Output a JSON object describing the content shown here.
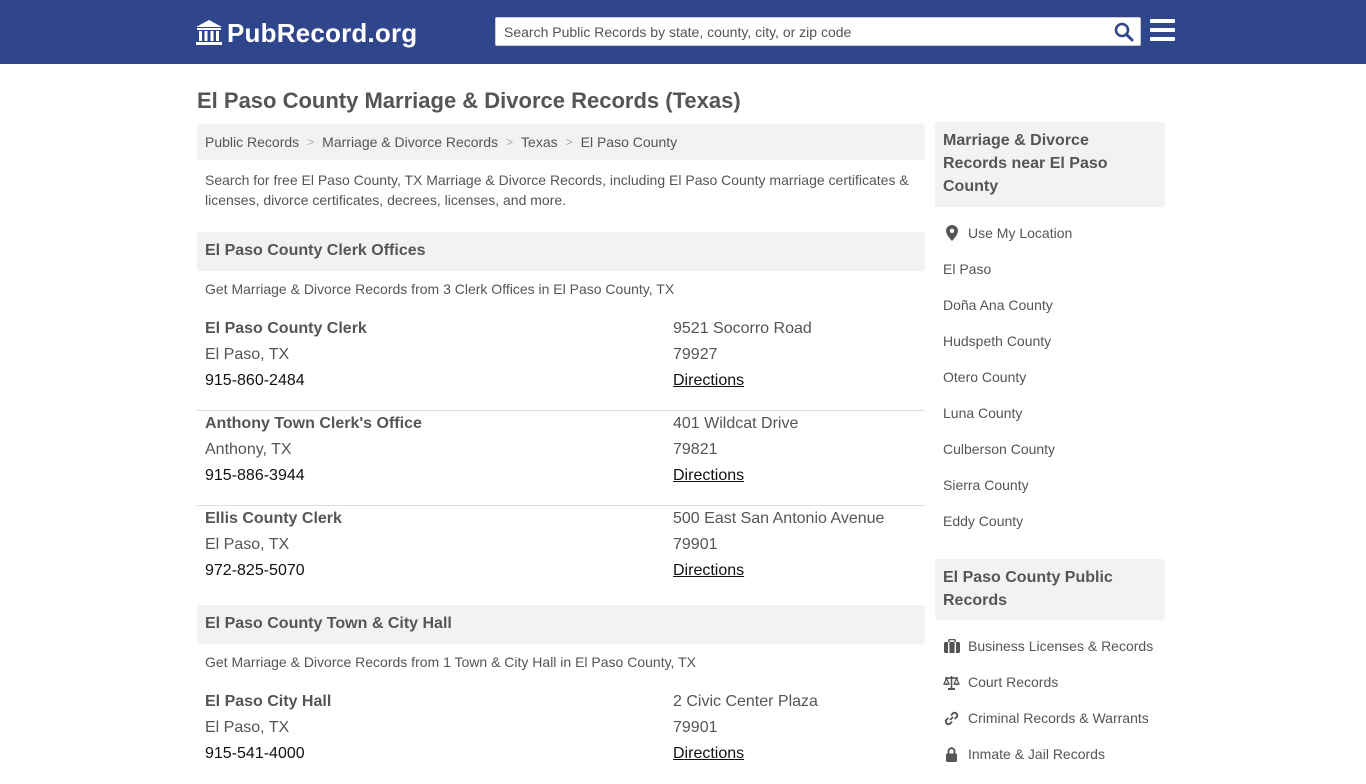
{
  "header": {
    "logo_text": "PubRecord.org",
    "search_placeholder": "Search Public Records by state, county, city, or zip code"
  },
  "page": {
    "title": "El Paso County Marriage & Divorce Records (Texas)",
    "intro": "Search for free El Paso County, TX Marriage & Divorce Records, including El Paso County marriage certificates & licenses, divorce certificates, decrees, licenses, and more."
  },
  "breadcrumb": [
    "Public Records",
    "Marriage & Divorce Records",
    "Texas",
    "El Paso County"
  ],
  "clerk_section": {
    "title": "El Paso County Clerk Offices",
    "subtitle": "Get Marriage & Divorce Records from 3 Clerk Offices in El Paso County, TX",
    "offices": [
      {
        "name": "El Paso County Clerk",
        "city": "El Paso, TX",
        "phone": "915-860-2484",
        "address": "9521 Socorro Road",
        "zip": "79927",
        "directions": "Directions"
      },
      {
        "name": "Anthony Town Clerk's Office",
        "city": "Anthony, TX",
        "phone": "915-886-3944",
        "address": "401 Wildcat Drive",
        "zip": "79821",
        "directions": "Directions"
      },
      {
        "name": "Ellis County Clerk",
        "city": "El Paso, TX",
        "phone": "972-825-5070",
        "address": "500 East San Antonio Avenue",
        "zip": "79901",
        "directions": "Directions"
      }
    ]
  },
  "hall_section": {
    "title": "El Paso County Town & City Hall",
    "subtitle": "Get Marriage & Divorce Records from 1 Town & City Hall in El Paso County, TX",
    "offices": [
      {
        "name": "El Paso City Hall",
        "city": "El Paso, TX",
        "phone": "915-541-4000",
        "address": "2 Civic Center Plaza",
        "zip": "79901",
        "directions": "Directions"
      }
    ]
  },
  "sidebar": {
    "nearby_title": "Marriage & Divorce Records near El Paso County",
    "use_location": "Use My Location",
    "nearby": [
      "El Paso",
      "Doña Ana County",
      "Hudspeth County",
      "Otero County",
      "Luna County",
      "Culberson County",
      "Sierra County",
      "Eddy County"
    ],
    "public_title": "El Paso County Public Records",
    "public_links": [
      {
        "label": "Business Licenses & Records",
        "icon": "briefcase-icon"
      },
      {
        "label": "Court Records",
        "icon": "scales-icon"
      },
      {
        "label": "Criminal Records & Warrants",
        "icon": "link-icon"
      },
      {
        "label": "Inmate & Jail Records",
        "icon": "lock-icon"
      }
    ]
  },
  "colors": {
    "header_bg": "#30468c",
    "panel_bg": "#f2f2f2",
    "text": "#555555"
  }
}
